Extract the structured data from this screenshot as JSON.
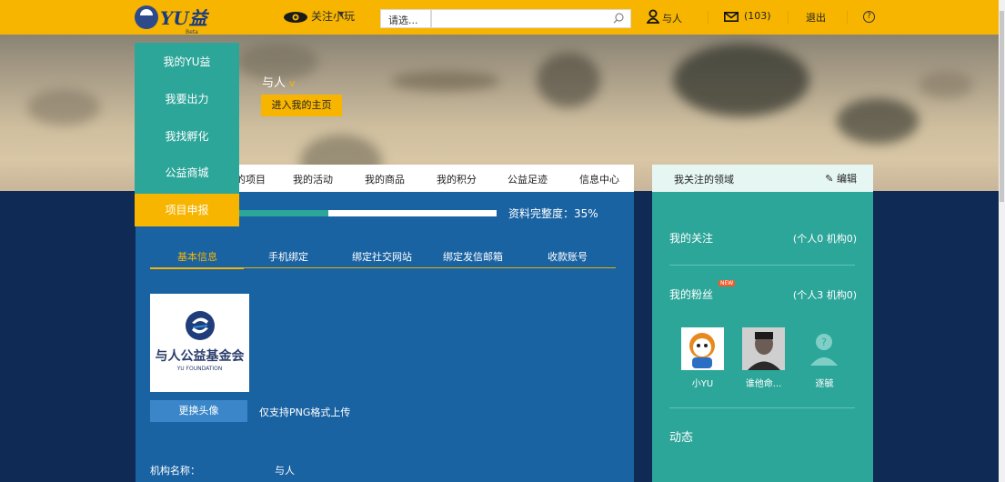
{
  "app": {
    "logo_text": "YU益",
    "logo_beta": "Beta"
  },
  "topbar": {
    "attention_label": "关注小玩",
    "select_label": "请选...",
    "search_placeholder": "",
    "user_name": "与人",
    "mail_count": "(103)",
    "logout_label": "退出",
    "help_glyph": "?",
    "accent_color": "#f7b500"
  },
  "dropdown": {
    "items": [
      {
        "label": "我的YU益"
      },
      {
        "label": "我要出力"
      },
      {
        "label": "我找孵化"
      },
      {
        "label": "公益商城"
      },
      {
        "label": "项目申报"
      }
    ]
  },
  "profile": {
    "name": "与人",
    "v_badge": "v",
    "enter_home_label": "进入我的主页"
  },
  "nav": {
    "items": [
      {
        "label": "的项目"
      },
      {
        "label": "我的活动"
      },
      {
        "label": "我的商品"
      },
      {
        "label": "我的积分"
      },
      {
        "label": "公益足迹"
      },
      {
        "label": "信息中心"
      }
    ]
  },
  "progress": {
    "label": "资料完整度：35%",
    "value": 0.35
  },
  "tabs": [
    {
      "label": "基本信息"
    },
    {
      "label": "手机绑定"
    },
    {
      "label": "绑定社交网站"
    },
    {
      "label": "绑定发信邮箱"
    },
    {
      "label": "收款账号"
    }
  ],
  "avatar": {
    "org_caption": "与人公益基金会",
    "org_caption_en": "YU FOUNDATION"
  },
  "change_avatar_label": "更换头像",
  "upload_note": "仅支持PNG格式上传",
  "org": {
    "label": "机构名称：",
    "value": "与人"
  },
  "right": {
    "fields_label": "我关注的领域",
    "edit_label": "编辑",
    "follow_label": "我的关注",
    "follow_counts": "(个人0  机构0)",
    "fans_label": "我的粉丝",
    "new_badge": "NEW",
    "fans_counts": "(个人3  机构0)",
    "fans": [
      {
        "name": "小YU"
      },
      {
        "name": "谁他命..."
      },
      {
        "name": "逐毓"
      }
    ],
    "feed_label": "动态"
  }
}
